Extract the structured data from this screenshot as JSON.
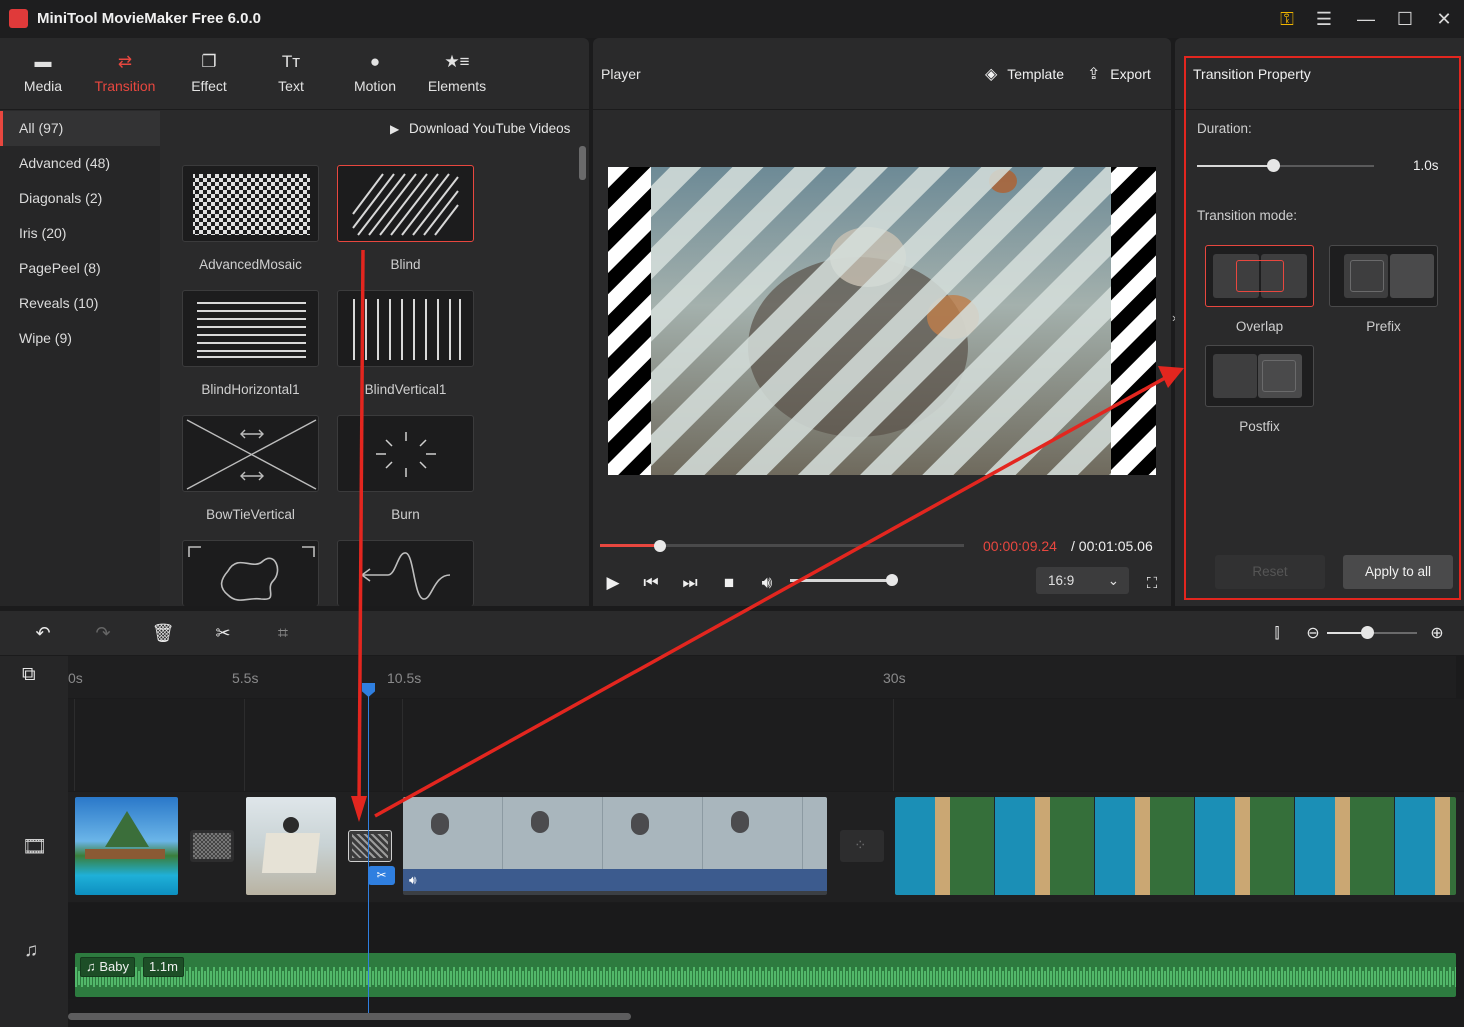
{
  "app": {
    "title": "MiniTool MovieMaker Free 6.0.0",
    "icons": [
      "key-icon",
      "menu-icon",
      "minimize-icon",
      "maximize-icon",
      "close-icon"
    ]
  },
  "toolbar": {
    "items": [
      {
        "label": "Media",
        "icon": "folder-icon"
      },
      {
        "label": "Transition",
        "icon": "swap-arrows-icon",
        "active": true
      },
      {
        "label": "Effect",
        "icon": "layers-icon"
      },
      {
        "label": "Text",
        "icon": "text-icon"
      },
      {
        "label": "Motion",
        "icon": "motion-icon"
      },
      {
        "label": "Elements",
        "icon": "elements-icon"
      }
    ]
  },
  "categories": [
    {
      "label": "All (97)",
      "active": true
    },
    {
      "label": "Advanced (48)"
    },
    {
      "label": "Diagonals (2)"
    },
    {
      "label": "Iris (20)"
    },
    {
      "label": "PagePeel (8)"
    },
    {
      "label": "Reveals (10)"
    },
    {
      "label": "Wipe (9)"
    }
  ],
  "download_link": "Download YouTube Videos",
  "transitions": [
    {
      "label": "AdvancedMosaic"
    },
    {
      "label": "Blind",
      "selected": true
    },
    {
      "label": "BlindHorizontal1"
    },
    {
      "label": "BlindVertical1"
    },
    {
      "label": "BowTieVertical"
    },
    {
      "label": "Burn"
    },
    {
      "label": ""
    },
    {
      "label": ""
    }
  ],
  "player": {
    "title": "Player",
    "template_label": "Template",
    "export_label": "Export",
    "current_time": "00:00:09.24",
    "total_time": "/ 00:01:05.06",
    "aspect_ratio": "16:9",
    "progress": 0.16,
    "volume": 1.0
  },
  "property": {
    "title": "Transition Property",
    "duration_label": "Duration:",
    "duration_value": "1.0s",
    "mode_label": "Transition mode:",
    "modes": [
      {
        "label": "Overlap",
        "selected": true
      },
      {
        "label": "Prefix"
      },
      {
        "label": "Postfix"
      }
    ],
    "reset_label": "Reset",
    "apply_label": "Apply to all"
  },
  "timeline": {
    "ruler": [
      "0s",
      "5.5s",
      "10.5s",
      "30s"
    ],
    "audio": {
      "name": "Baby",
      "length": "1.1m"
    }
  },
  "colors": {
    "accent": "#e8473f",
    "playhead": "#2f7fe0",
    "audio": "#2d7b3f"
  }
}
